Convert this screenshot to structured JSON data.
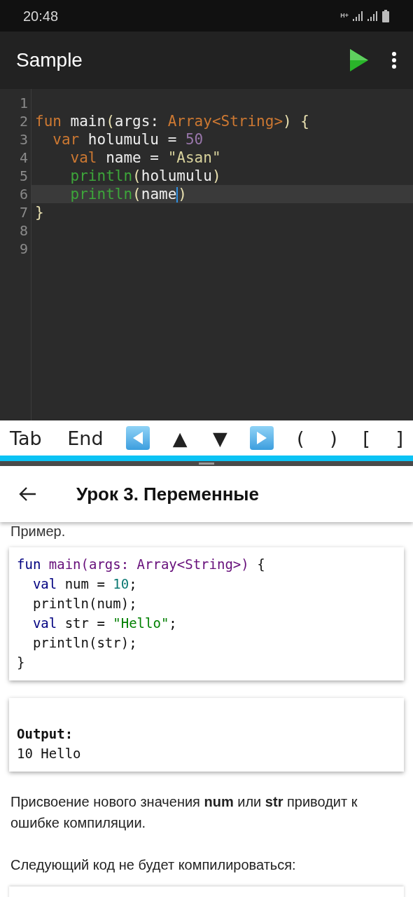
{
  "status_bar": {
    "time": "20:48",
    "network_type": "H+"
  },
  "toolbar": {
    "title": "Sample"
  },
  "editor": {
    "lines": [
      {
        "number": "1",
        "selected": false
      },
      {
        "number": "2",
        "selected": false,
        "tokens": [
          {
            "kind": "keyword",
            "text": "fun"
          },
          {
            "kind": "plain",
            "text": " main"
          },
          {
            "kind": "punct",
            "text": "("
          },
          {
            "kind": "plain",
            "text": "args: "
          },
          {
            "kind": "type",
            "text": "Array<String>"
          },
          {
            "kind": "punct",
            "text": ") {"
          }
        ]
      },
      {
        "number": "3",
        "selected": false,
        "tokens": [
          {
            "kind": "keyword",
            "text": "  var"
          },
          {
            "kind": "plain",
            "text": " holumulu = "
          },
          {
            "kind": "number",
            "text": "50"
          }
        ]
      },
      {
        "number": "4",
        "selected": false,
        "tokens": [
          {
            "kind": "keyword",
            "text": "    val"
          },
          {
            "kind": "plain",
            "text": " name = "
          },
          {
            "kind": "string",
            "text": "\"Asan\""
          }
        ]
      },
      {
        "number": "5",
        "selected": false,
        "tokens": [
          {
            "kind": "call",
            "text": "    println"
          },
          {
            "kind": "punct",
            "text": "("
          },
          {
            "kind": "plain",
            "text": "holumulu"
          },
          {
            "kind": "punct",
            "text": ")"
          }
        ]
      },
      {
        "number": "6",
        "selected": true,
        "tokens": [
          {
            "kind": "call",
            "text": "    println"
          },
          {
            "kind": "punct",
            "text": "("
          },
          {
            "kind": "plain",
            "text": "name",
            "cursor": true
          },
          {
            "kind": "punct",
            "text": ")"
          }
        ]
      },
      {
        "number": "7",
        "selected": false,
        "tokens": [
          {
            "kind": "punct",
            "text": "}"
          }
        ]
      },
      {
        "number": "8",
        "selected": false
      },
      {
        "number": "9",
        "selected": false
      }
    ]
  },
  "keys": [
    {
      "kind": "text",
      "label": "Tab"
    },
    {
      "kind": "text",
      "label": "End"
    },
    {
      "kind": "left"
    },
    {
      "kind": "text",
      "label": "▲"
    },
    {
      "kind": "text",
      "label": "▼"
    },
    {
      "kind": "right"
    },
    {
      "kind": "text",
      "label": "("
    },
    {
      "kind": "text",
      "label": ")"
    },
    {
      "kind": "text",
      "label": "["
    },
    {
      "kind": "text",
      "label": "]"
    }
  ],
  "lesson": {
    "title": "Урок 3. Переменные",
    "caption": "Пример.",
    "code": [
      [
        {
          "kind": "keyword",
          "text": "fun"
        },
        {
          "kind": "func",
          "text": " main(args: Array<String>)"
        },
        {
          "kind": "plain",
          "text": " {"
        }
      ],
      [
        {
          "kind": "keyword",
          "text": "  val"
        },
        {
          "kind": "plain",
          "text": " num = "
        },
        {
          "kind": "number",
          "text": "10"
        },
        {
          "kind": "plain",
          "text": ";"
        }
      ],
      [
        {
          "kind": "plain",
          "text": "  println(num);"
        }
      ],
      [
        {
          "kind": "keyword",
          "text": "  val"
        },
        {
          "kind": "plain",
          "text": " str = "
        },
        {
          "kind": "string",
          "text": "\"Hello\""
        },
        {
          "kind": "plain",
          "text": ";"
        }
      ],
      [
        {
          "kind": "plain",
          "text": "  println(str);"
        }
      ],
      [
        {
          "kind": "plain",
          "text": "}"
        }
      ]
    ],
    "output_label": "Output:",
    "output": "10 Hello",
    "paragraphs": [
      "Присвоение нового значения **num** или **str** приводит к ошибке компиляции.",
      "Следующий код не будет компилироваться:"
    ]
  }
}
